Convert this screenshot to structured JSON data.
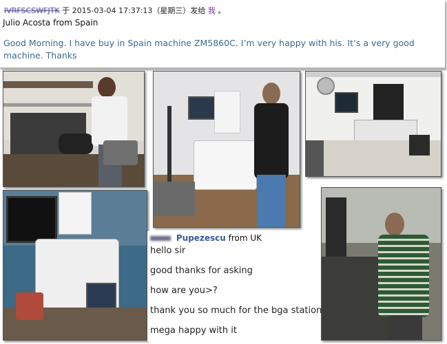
{
  "header": {
    "sender": "IVRFSCSWFJTK",
    "middle": "于 2015-03-04 17:37:13（星期三）发给",
    "recipient": "我",
    "end": "。",
    "subtitle": "Julio Acosta from  Spain"
  },
  "message": {
    "text": "Good Morning. I have buy in Spain machine ZM5860C. I’m very happy with his. It’s a very good machine. Thanks"
  },
  "chat": {
    "name": "Pupezescu",
    "origin": "from UK",
    "lines": [
      "hello sir",
      "good thanks for asking",
      "how are you>?",
      "thank you so much for the bga station",
      "mega happy with it"
    ]
  },
  "colors": {
    "message_text": "#3a6a8e",
    "chat_name": "#3a5a9a",
    "recipient": "#7a2fa8"
  }
}
